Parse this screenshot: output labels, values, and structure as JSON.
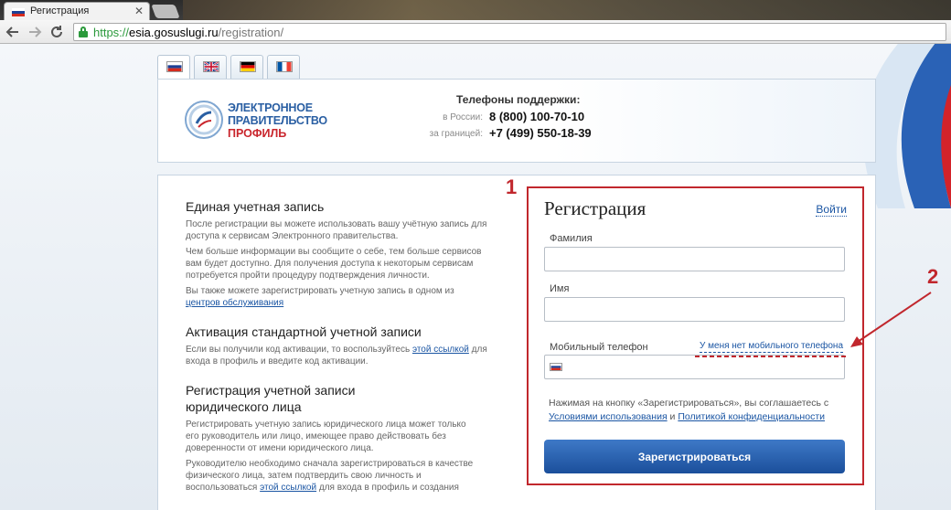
{
  "browser": {
    "tab_title": "Регистрация",
    "tab_close": "✕",
    "url_scheme": "https://",
    "url_host": "esia.gosuslugi.ru",
    "url_path": "/registration/",
    "back_icon": "🡐",
    "forward_icon": "🡒",
    "reload_icon": "↻"
  },
  "languages": [
    "ru",
    "en",
    "de",
    "fr"
  ],
  "header": {
    "logo_line1": "ЭЛЕКТРОННОЕ",
    "logo_line2": "ПРАВИТЕЛЬСТВО",
    "logo_line3": "ПРОФИЛЬ",
    "support_title": "Телефоны поддержки:",
    "russia_label": "в России:",
    "russia_number": "8 (800) 100-70-10",
    "abroad_label": "за границей:",
    "abroad_number": "+7 (499) 550-18-39"
  },
  "info": {
    "s1_title": "Единая учетная запись",
    "s1_p1": "После регистрации вы можете использовать вашу учётную запись для доступа к сервисам Электронного правительства.",
    "s1_p2": "Чем больше информации вы сообщите о себе, тем больше сервисов вам будет доступно. Для получения доступа к некоторым сервисам потребуется пройти процедуру подтверждения личности.",
    "s1_p3_text": "Вы также можете зарегистрировать учетную запись в одном из",
    "s1_p3_link": "центров обслуживания",
    "s2_title": "Активация стандартной учетной записи",
    "s2_p1_a": "Если вы получили код активации, то воспользуйтесь",
    "s2_p1_link": "этой ссылкой",
    "s2_p1_b": "для входа в профиль и введите код активации.",
    "s3_title": "Регистрация учетной записи юридического лица",
    "s3_p1": "Регистрировать учетную запись юридического лица может только его руководитель или лицо, имеющее право действовать без доверенности от имени юридического лица.",
    "s3_p2_a": "Руководителю необходимо сначала зарегистрироваться в качестве физического лица, затем подтвердить свою личность и воспользоваться",
    "s3_p2_link": "этой ссылкой",
    "s3_p2_b": "для входа в профиль и создания"
  },
  "registration": {
    "title": "Регистрация",
    "login_link": "Войти",
    "surname_label": "Фамилия",
    "name_label": "Имя",
    "phone_label": "Мобильный телефон",
    "no_phone_link": "У меня нет мобильного телефона",
    "terms_text": "Нажимая на кнопку «Зарегистрироваться», вы соглашаетесь с",
    "terms_link": "Условиями использования",
    "terms_and": "и",
    "privacy_link": "Политикой конфиденциальности",
    "submit_label": "Зарегистрироваться"
  },
  "annotations": {
    "marker_1": "1",
    "marker_2": "2",
    "color": "#c1272d"
  }
}
